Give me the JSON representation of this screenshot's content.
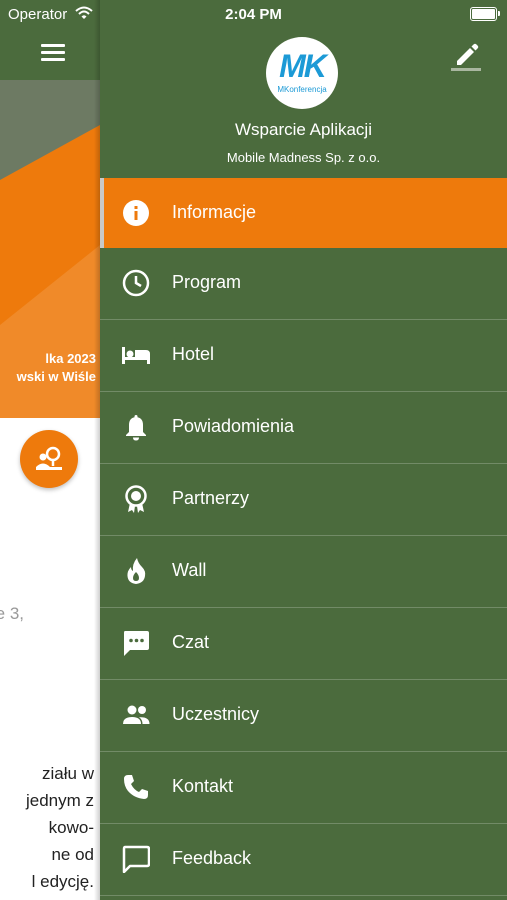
{
  "status_bar": {
    "carrier": "Operator",
    "time": "2:04 PM",
    "wifi_icon": "wifi-icon",
    "battery_icon": "battery-icon"
  },
  "background_page": {
    "menu_icon": "hamburger-icon",
    "hero_line_1": "lka 2023",
    "hero_line_2": "wski w Wiśle",
    "fab_icon": "location-person-icon",
    "address_fragment": "e 3,",
    "body_lines": [
      "ziału w",
      "jednym z",
      "kowo-",
      "ne od",
      "l edycję."
    ]
  },
  "drawer": {
    "logo": {
      "letters": "MK",
      "subtitle": "MKonferencja"
    },
    "user_name": "Wsparcie Aplikacji",
    "company": "Mobile Madness Sp. z o.o.",
    "edit_icon": "pencil-icon",
    "menu_items": [
      {
        "label": "Informacje",
        "icon": "info-icon",
        "active": true
      },
      {
        "label": "Program",
        "icon": "clock-icon",
        "active": false
      },
      {
        "label": "Hotel",
        "icon": "bed-icon",
        "active": false
      },
      {
        "label": "Powiadomienia",
        "icon": "bell-icon",
        "active": false
      },
      {
        "label": "Partnerzy",
        "icon": "badge-icon",
        "active": false
      },
      {
        "label": "Wall",
        "icon": "flame-icon",
        "active": false
      },
      {
        "label": "Czat",
        "icon": "chat-icon",
        "active": false
      },
      {
        "label": "Uczestnicy",
        "icon": "people-icon",
        "active": false
      },
      {
        "label": "Kontakt",
        "icon": "phone-icon",
        "active": false
      },
      {
        "label": "Feedback",
        "icon": "feedback-icon",
        "active": false
      }
    ]
  },
  "colors": {
    "drawer_background": "#4b6b3d",
    "accent": "#ee7a0c",
    "logo_blue": "#1c9ad6"
  }
}
